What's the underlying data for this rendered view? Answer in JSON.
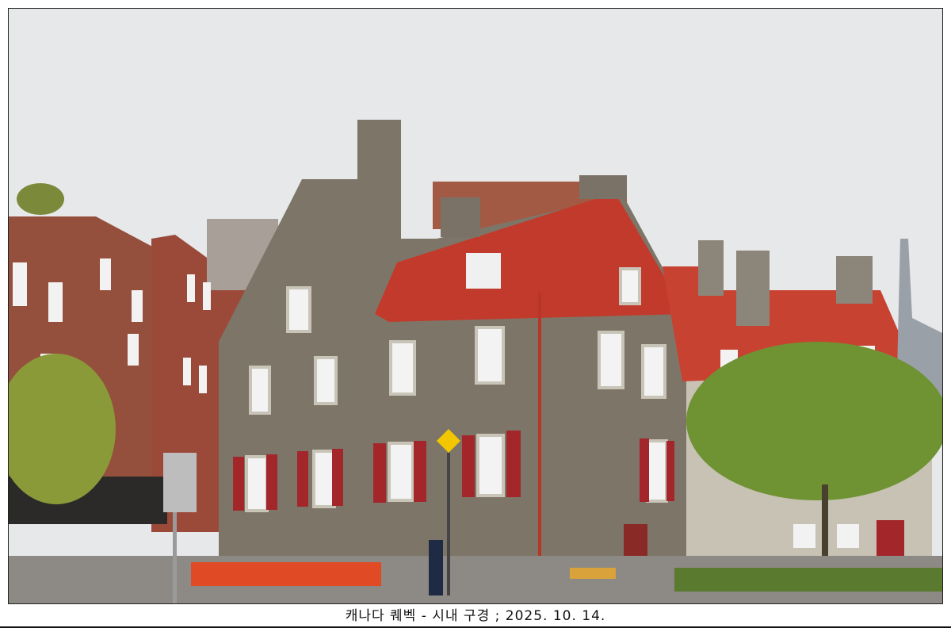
{
  "caption": "캐나다 퀘벡 - 시내 구경 ; 2025. 10. 14.",
  "colors": {
    "sky": "#e6e8ea",
    "stone": "#7d7668",
    "roof_red": "#c23a2c",
    "shutter": "#a3262a",
    "brick": "#9a4a36",
    "tree": "#7a9a3a"
  }
}
